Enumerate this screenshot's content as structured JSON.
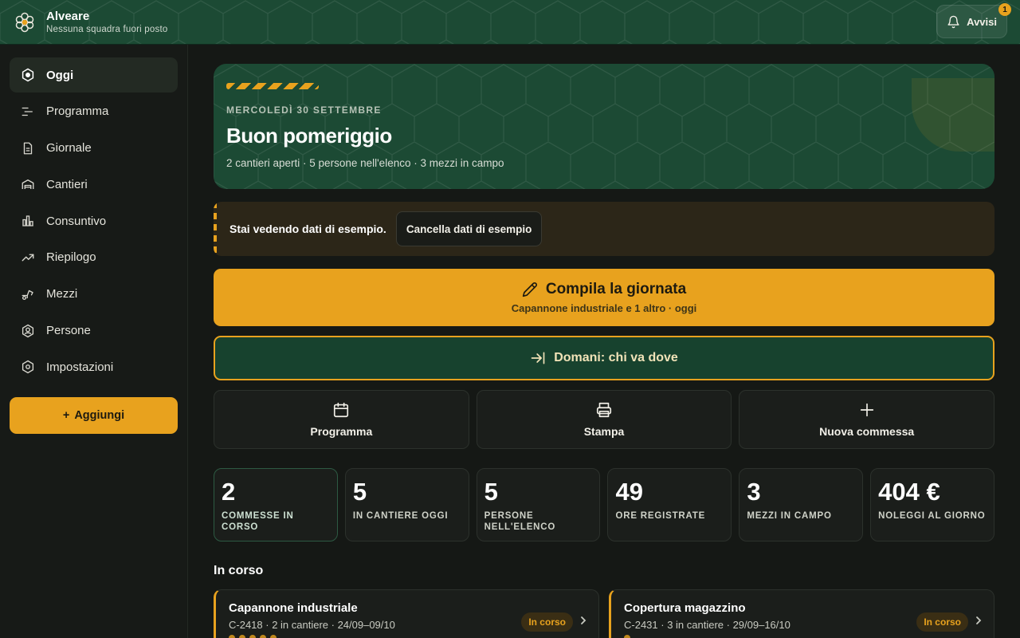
{
  "app": {
    "name": "Alveare",
    "subtitle": "Nessuna squadra fuori posto",
    "alerts_label": "Avvisi",
    "alerts_count": "1"
  },
  "sidebar": {
    "items": [
      {
        "label": "Oggi",
        "icon": "hexagon-icon",
        "active": true
      },
      {
        "label": "Programma",
        "icon": "gantt-icon"
      },
      {
        "label": "Giornale",
        "icon": "document-icon"
      },
      {
        "label": "Cantieri",
        "icon": "warehouse-icon"
      },
      {
        "label": "Consuntivo",
        "icon": "bar-chart-icon"
      },
      {
        "label": "Riepilogo",
        "icon": "trend-icon"
      },
      {
        "label": "Mezzi",
        "icon": "excavator-icon"
      },
      {
        "label": "Persone",
        "icon": "person-icon"
      },
      {
        "label": "Impostazioni",
        "icon": "settings-icon"
      }
    ],
    "add_label": "Aggiungi"
  },
  "hero": {
    "date": "MERCOLEDÌ 30 SETTEMBRE",
    "greeting": "Buon pomeriggio",
    "summary": "2 cantieri aperti · 5 persone nell'elenco · 3 mezzi in campo"
  },
  "sample_notice": {
    "text": "Stai vedendo dati di esempio.",
    "button": "Cancella dati di esempio"
  },
  "cta": {
    "title": "Compila la giornata",
    "subtitle": "Capannone industriale e 1 altro · oggi"
  },
  "tomorrow": {
    "label": "Domani: chi va dove"
  },
  "actions": [
    {
      "label": "Programma",
      "icon": "calendar-icon"
    },
    {
      "label": "Stampa",
      "icon": "printer-icon"
    },
    {
      "label": "Nuova commessa",
      "icon": "plus-icon"
    }
  ],
  "stats": [
    {
      "value": "2",
      "label": "COMMESSE IN CORSO"
    },
    {
      "value": "5",
      "label": "IN CANTIERE OGGI"
    },
    {
      "value": "5",
      "label": "PERSONE NELL'ELENCO"
    },
    {
      "value": "49",
      "label": "ORE REGISTRATE"
    },
    {
      "value": "3",
      "label": "MEZZI IN CAMPO"
    },
    {
      "value": "404 €",
      "label": "NOLEGGI AL GIORNO"
    }
  ],
  "in_progress": {
    "title": "In corso",
    "jobs": [
      {
        "title": "Capannone industriale",
        "meta": "C-2418 · 2 in cantiere · 24/09–09/10",
        "status": "In corso"
      },
      {
        "title": "Copertura magazzino",
        "meta": "C-2431 · 3 in cantiere · 29/09–16/10",
        "status": "In corso"
      }
    ]
  },
  "colors": {
    "accent": "#e8a21e",
    "brand_green": "#1c4a34",
    "background": "#151815"
  }
}
